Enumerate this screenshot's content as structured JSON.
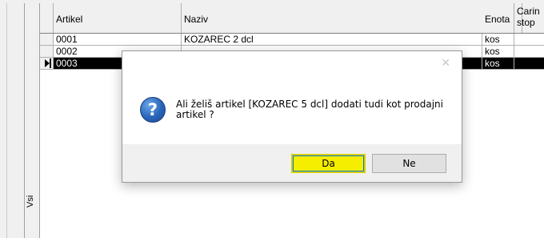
{
  "side_tab": {
    "label": "Vsi"
  },
  "grid": {
    "columns": [
      "Artikel",
      "Naziv",
      "Enota",
      "Carin stop"
    ],
    "rows": [
      {
        "artikel": "0001",
        "naziv": "KOZAREC 2 dcl",
        "enota": "kos",
        "carin": ""
      },
      {
        "artikel": "0002",
        "naziv": "",
        "enota": "kos",
        "carin": ""
      },
      {
        "artikel": "0003",
        "naziv": "",
        "enota": "kos",
        "carin": "",
        "selected": true
      }
    ]
  },
  "dialog": {
    "close_glyph": "✕",
    "icon": "question-icon",
    "icon_glyph": "?",
    "message": "Ali želiš artikel [KOZAREC 5 dcl] dodati tudi kot prodajni artikel ?",
    "yes_label": "Da",
    "no_label": "Ne"
  },
  "colors": {
    "primary_button": "#f5ee00",
    "selected_row": "#000000",
    "icon_blue": "#2a64b8"
  }
}
